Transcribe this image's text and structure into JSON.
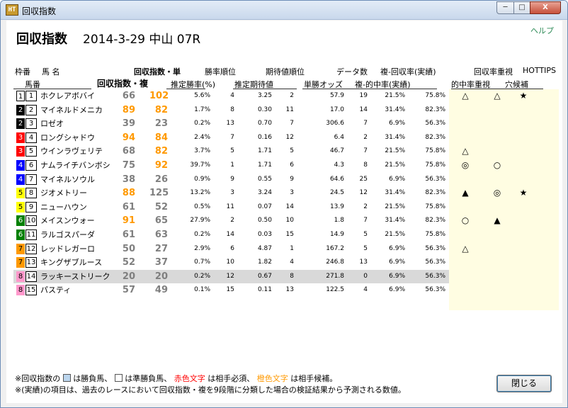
{
  "window": {
    "title": "回収指数",
    "app_icon": "HT",
    "min_label": "─",
    "max_label": "□",
    "close_label": "X"
  },
  "page": {
    "title": "回収指数",
    "race_info": "2014-3-29 中山 07R",
    "help": "ヘルプ"
  },
  "header": {
    "waku": "枠番",
    "uma": "馬 名",
    "umaban": "馬番",
    "idx_single": "回収指数・単",
    "idx_place": "回収指数・複",
    "win_rank": "勝率順位",
    "est_win_rate": "推定勝率(%)",
    "exp_rank": "期待値順位",
    "est_exp": "推定期待値",
    "odds": "単勝オッズ",
    "data_count": "データ数",
    "place_return": "複-回収率(実績)",
    "place_hit": "複-的中率(実績)",
    "return_focus": "回収率重視",
    "hit_focus": "的中率重視",
    "hottips": "HOTTIPS",
    "dark_horse": "穴候補"
  },
  "colors": {
    "red": "#ff0000",
    "orange": "#ff9900",
    "gray": "#7f7f7f",
    "shade": "#d9d9d9",
    "panel": "#fffde2"
  },
  "waku_colors": {
    "1": [
      "#ffffff",
      "#000000"
    ],
    "2": [
      "#000000",
      "#ffffff"
    ],
    "3": [
      "#ff0000",
      "#ffffff"
    ],
    "4": [
      "#0000ff",
      "#ffffff"
    ],
    "5": [
      "#ffff00",
      "#000000"
    ],
    "6": [
      "#008000",
      "#ffffff"
    ],
    "7": [
      "#ff9900",
      "#000000"
    ],
    "8": [
      "#ff99cc",
      "#000000"
    ]
  },
  "horses": [
    {
      "waku": "1",
      "num": "1",
      "name": "ホクレアボバイ",
      "idx1": "66",
      "idx2": "102",
      "c1": "gray",
      "c2": "orange",
      "win": "5.6%",
      "winrank": "4",
      "exp": "3.25",
      "exprank": "2",
      "odds": "57.9",
      "count": "19",
      "fr": "21.5%",
      "rr": "75.8%",
      "shaded": false,
      "m1": "△",
      "m2": "△",
      "m3": "★"
    },
    {
      "waku": "2",
      "num": "2",
      "name": "マイネルドメニカ",
      "idx1": "89",
      "idx2": "82",
      "c1": "orange",
      "c2": "orange",
      "win": "1.7%",
      "winrank": "8",
      "exp": "0.30",
      "exprank": "11",
      "odds": "17.0",
      "count": "14",
      "fr": "31.4%",
      "rr": "82.3%",
      "shaded": false,
      "m1": "",
      "m2": "",
      "m3": ""
    },
    {
      "waku": "2",
      "num": "3",
      "name": "ロゼオ",
      "idx1": "39",
      "idx2": "23",
      "c1": "gray",
      "c2": "gray",
      "win": "0.2%",
      "winrank": "13",
      "exp": "0.70",
      "exprank": "7",
      "odds": "306.6",
      "count": "7",
      "fr": "6.9%",
      "rr": "56.3%",
      "shaded": false,
      "m1": "",
      "m2": "",
      "m3": ""
    },
    {
      "waku": "3",
      "num": "4",
      "name": "ロングシャドウ",
      "idx1": "94",
      "idx2": "84",
      "c1": "orange",
      "c2": "orange",
      "win": "2.4%",
      "winrank": "7",
      "exp": "0.16",
      "exprank": "12",
      "odds": "6.4",
      "count": "2",
      "fr": "31.4%",
      "rr": "82.3%",
      "shaded": false,
      "m1": "",
      "m2": "",
      "m3": ""
    },
    {
      "waku": "3",
      "num": "5",
      "name": "ウインラヴェリテ",
      "idx1": "68",
      "idx2": "82",
      "c1": "gray",
      "c2": "orange",
      "win": "3.7%",
      "winrank": "5",
      "exp": "1.71",
      "exprank": "5",
      "odds": "46.7",
      "count": "7",
      "fr": "21.5%",
      "rr": "75.8%",
      "shaded": false,
      "m1": "△",
      "m2": "",
      "m3": ""
    },
    {
      "waku": "4",
      "num": "6",
      "name": "ナムライチバンボシ",
      "idx1": "75",
      "idx2": "92",
      "c1": "gray",
      "c2": "orange",
      "win": "39.7%",
      "winrank": "1",
      "exp": "1.71",
      "exprank": "6",
      "odds": "4.3",
      "count": "8",
      "fr": "21.5%",
      "rr": "75.8%",
      "shaded": false,
      "m1": "◎",
      "m2": "○",
      "m3": ""
    },
    {
      "waku": "4",
      "num": "7",
      "name": "マイネルソウル",
      "idx1": "38",
      "idx2": "26",
      "c1": "gray",
      "c2": "gray",
      "win": "0.9%",
      "winrank": "9",
      "exp": "0.55",
      "exprank": "9",
      "odds": "64.6",
      "count": "25",
      "fr": "6.9%",
      "rr": "56.3%",
      "shaded": false,
      "m1": "",
      "m2": "",
      "m3": ""
    },
    {
      "waku": "5",
      "num": "8",
      "name": "ジオメトリー",
      "idx1": "88",
      "idx2": "125",
      "c1": "orange",
      "c2": "gray",
      "win": "13.2%",
      "winrank": "3",
      "exp": "3.24",
      "exprank": "3",
      "odds": "24.5",
      "count": "12",
      "fr": "31.4%",
      "rr": "82.3%",
      "shaded": false,
      "m1": "▲",
      "m2": "◎",
      "m3": "★"
    },
    {
      "waku": "5",
      "num": "9",
      "name": "ニューハウン",
      "idx1": "61",
      "idx2": "52",
      "c1": "gray",
      "c2": "gray",
      "win": "0.5%",
      "winrank": "11",
      "exp": "0.07",
      "exprank": "14",
      "odds": "13.9",
      "count": "2",
      "fr": "21.5%",
      "rr": "75.8%",
      "shaded": false,
      "m1": "",
      "m2": "",
      "m3": ""
    },
    {
      "waku": "6",
      "num": "10",
      "name": "メイスンウォー",
      "idx1": "91",
      "idx2": "65",
      "c1": "orange",
      "c2": "gray",
      "win": "27.9%",
      "winrank": "2",
      "exp": "0.50",
      "exprank": "10",
      "odds": "1.8",
      "count": "7",
      "fr": "31.4%",
      "rr": "82.3%",
      "shaded": false,
      "m1": "○",
      "m2": "▲",
      "m3": ""
    },
    {
      "waku": "6",
      "num": "11",
      "name": "ラルゴスパーダ",
      "idx1": "61",
      "idx2": "63",
      "c1": "gray",
      "c2": "gray",
      "win": "0.2%",
      "winrank": "14",
      "exp": "0.03",
      "exprank": "15",
      "odds": "14.9",
      "count": "5",
      "fr": "21.5%",
      "rr": "75.8%",
      "shaded": false,
      "m1": "",
      "m2": "",
      "m3": ""
    },
    {
      "waku": "7",
      "num": "12",
      "name": "レッドレガーロ",
      "idx1": "50",
      "idx2": "27",
      "c1": "gray",
      "c2": "gray",
      "win": "2.9%",
      "winrank": "6",
      "exp": "4.87",
      "exprank": "1",
      "odds": "167.2",
      "count": "5",
      "fr": "6.9%",
      "rr": "56.3%",
      "shaded": false,
      "m1": "△",
      "m2": "",
      "m3": ""
    },
    {
      "waku": "7",
      "num": "13",
      "name": "キングザブルース",
      "idx1": "52",
      "idx2": "37",
      "c1": "gray",
      "c2": "gray",
      "win": "0.7%",
      "winrank": "10",
      "exp": "1.82",
      "exprank": "4",
      "odds": "246.8",
      "count": "13",
      "fr": "6.9%",
      "rr": "56.3%",
      "shaded": false,
      "m1": "",
      "m2": "",
      "m3": ""
    },
    {
      "waku": "8",
      "num": "14",
      "name": "ラッキーストリーク",
      "idx1": "20",
      "idx2": "20",
      "c1": "gray",
      "c2": "gray",
      "win": "0.2%",
      "winrank": "12",
      "exp": "0.67",
      "exprank": "8",
      "odds": "271.8",
      "count": "0",
      "fr": "6.9%",
      "rr": "56.3%",
      "shaded": true,
      "m1": "",
      "m2": "",
      "m3": ""
    },
    {
      "waku": "8",
      "num": "15",
      "name": "パスティ",
      "idx1": "57",
      "idx2": "49",
      "c1": "gray",
      "c2": "gray",
      "win": "0.1%",
      "winrank": "15",
      "exp": "0.11",
      "exprank": "13",
      "odds": "122.5",
      "count": "4",
      "fr": "6.9%",
      "rr": "56.3%",
      "shaded": false,
      "m1": "",
      "m2": "",
      "m3": ""
    }
  ],
  "footer": {
    "line1_prefix": "※回収指数の",
    "line1_a": "は勝負馬、",
    "line1_b": "は準勝負馬、",
    "red_text": "赤色文字",
    "line1_c": " は相手必須、",
    "orange_text": "橙色文字",
    "line1_d": " は相手候補。",
    "line2": "※(実績)の項目は、過去のレースにおいて回収指数・複を9段階に分類した場合の検証結果から予測される数値。",
    "legend_light": "#bcd6ee",
    "legend_white": "#ffffff"
  },
  "buttons": {
    "close": "閉じる"
  }
}
